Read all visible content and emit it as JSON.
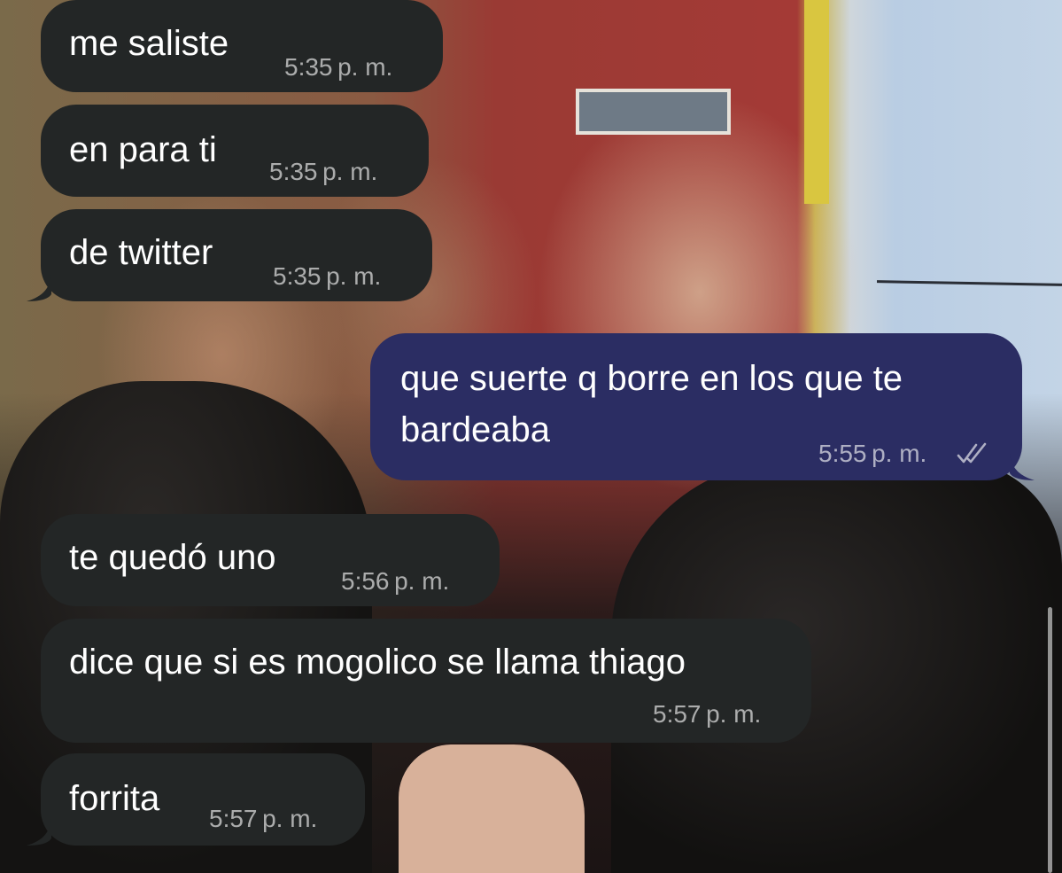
{
  "messages": [
    {
      "text": "me saliste",
      "time": "5:35 p. m."
    },
    {
      "text": "en para ti",
      "time": "5:35 p. m."
    },
    {
      "text": "de twitter",
      "time": "5:35 p. m."
    },
    {
      "text_line1": "que suerte q borre en los que te",
      "text_line2": "bardeaba",
      "time": "5:55 p. m."
    },
    {
      "text": "te quedó uno",
      "time": "5:56 p. m."
    },
    {
      "text": "dice que si es mogolico se llama thiago",
      "time": "5:57 p. m."
    },
    {
      "text": "forrita",
      "time": "5:57 p. m."
    }
  ],
  "colors": {
    "incoming_bubble": "#232626",
    "outgoing_bubble": "#2b2d63",
    "text": "#ffffff"
  },
  "icons": {
    "read_receipt": "double-check-icon"
  }
}
